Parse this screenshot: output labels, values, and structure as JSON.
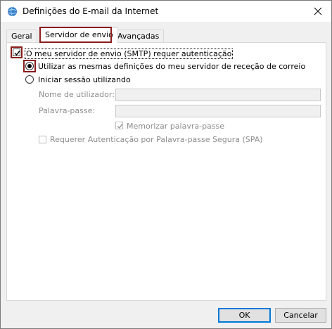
{
  "window": {
    "title": "Definições do E-mail da Internet"
  },
  "tabs": [
    {
      "label": "Geral"
    },
    {
      "label": "Servidor de envio"
    },
    {
      "label": "Avançadas"
    }
  ],
  "smtp_auth": {
    "label": "O meu servidor de envio (SMTP) requer autenticação",
    "checked": true
  },
  "same_settings": {
    "label": "Utilizar as mesmas definições do meu servidor de receção de correio",
    "selected": true
  },
  "login_with": {
    "label": "Iniciar sessão utilizando",
    "selected": false
  },
  "username": {
    "label": "Nome de utilizador:",
    "value": ""
  },
  "password": {
    "label": "Palavra-passe:",
    "value": ""
  },
  "remember_password": {
    "label": "Memorizar palavra-passe",
    "checked": true,
    "enabled": false
  },
  "spa": {
    "label": "Requerer Autenticação por Palavra-passe Segura (SPA)",
    "checked": false,
    "enabled": false
  },
  "buttons": {
    "ok": "OK",
    "cancel": "Cancelar"
  },
  "colors": {
    "highlight": "#8b1c1c",
    "default_button_border": "#0078d7"
  }
}
